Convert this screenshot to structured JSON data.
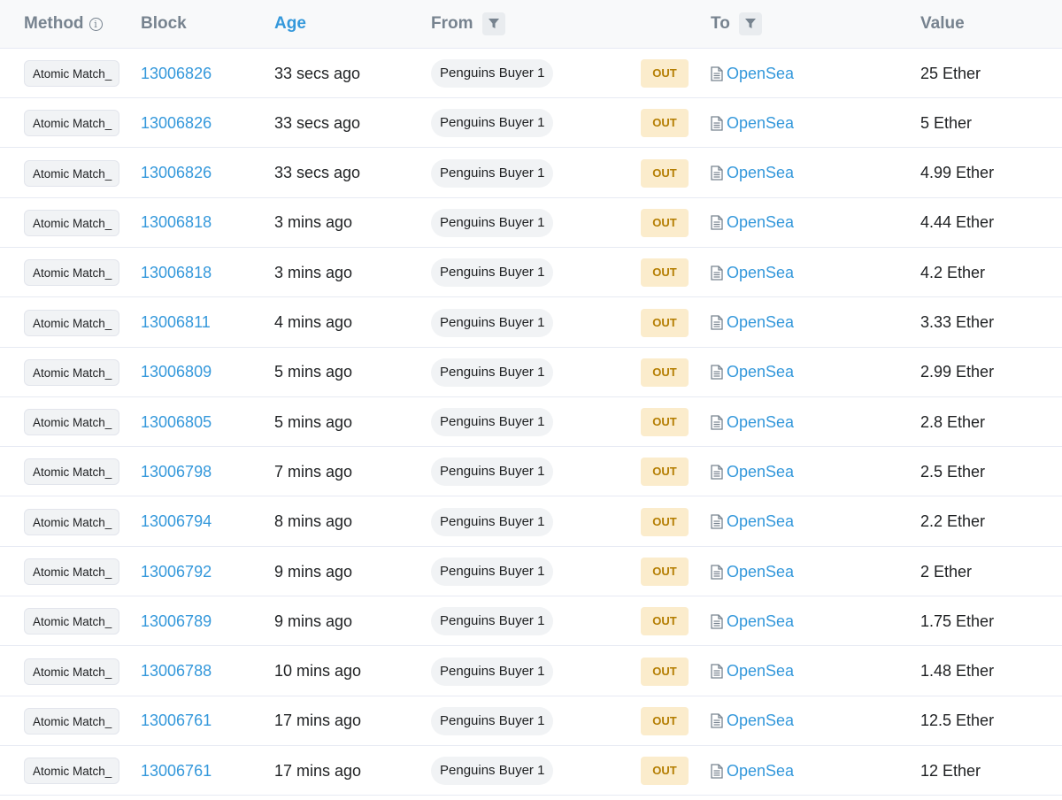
{
  "header": {
    "method": "Method",
    "block": "Block",
    "age": "Age",
    "from": "From",
    "to": "To",
    "value": "Value"
  },
  "rows": [
    {
      "method": "Atomic Match_",
      "block": "13006826",
      "age": "33 secs ago",
      "from": "Penguins Buyer 1",
      "direction": "OUT",
      "to": "OpenSea",
      "value": "25 Ether"
    },
    {
      "method": "Atomic Match_",
      "block": "13006826",
      "age": "33 secs ago",
      "from": "Penguins Buyer 1",
      "direction": "OUT",
      "to": "OpenSea",
      "value": "5 Ether"
    },
    {
      "method": "Atomic Match_",
      "block": "13006826",
      "age": "33 secs ago",
      "from": "Penguins Buyer 1",
      "direction": "OUT",
      "to": "OpenSea",
      "value": "4.99 Ether"
    },
    {
      "method": "Atomic Match_",
      "block": "13006818",
      "age": "3 mins ago",
      "from": "Penguins Buyer 1",
      "direction": "OUT",
      "to": "OpenSea",
      "value": "4.44 Ether"
    },
    {
      "method": "Atomic Match_",
      "block": "13006818",
      "age": "3 mins ago",
      "from": "Penguins Buyer 1",
      "direction": "OUT",
      "to": "OpenSea",
      "value": "4.2 Ether"
    },
    {
      "method": "Atomic Match_",
      "block": "13006811",
      "age": "4 mins ago",
      "from": "Penguins Buyer 1",
      "direction": "OUT",
      "to": "OpenSea",
      "value": "3.33 Ether"
    },
    {
      "method": "Atomic Match_",
      "block": "13006809",
      "age": "5 mins ago",
      "from": "Penguins Buyer 1",
      "direction": "OUT",
      "to": "OpenSea",
      "value": "2.99 Ether"
    },
    {
      "method": "Atomic Match_",
      "block": "13006805",
      "age": "5 mins ago",
      "from": "Penguins Buyer 1",
      "direction": "OUT",
      "to": "OpenSea",
      "value": "2.8 Ether"
    },
    {
      "method": "Atomic Match_",
      "block": "13006798",
      "age": "7 mins ago",
      "from": "Penguins Buyer 1",
      "direction": "OUT",
      "to": "OpenSea",
      "value": "2.5 Ether"
    },
    {
      "method": "Atomic Match_",
      "block": "13006794",
      "age": "8 mins ago",
      "from": "Penguins Buyer 1",
      "direction": "OUT",
      "to": "OpenSea",
      "value": "2.2 Ether"
    },
    {
      "method": "Atomic Match_",
      "block": "13006792",
      "age": "9 mins ago",
      "from": "Penguins Buyer 1",
      "direction": "OUT",
      "to": "OpenSea",
      "value": "2 Ether"
    },
    {
      "method": "Atomic Match_",
      "block": "13006789",
      "age": "9 mins ago",
      "from": "Penguins Buyer 1",
      "direction": "OUT",
      "to": "OpenSea",
      "value": "1.75 Ether"
    },
    {
      "method": "Atomic Match_",
      "block": "13006788",
      "age": "10 mins ago",
      "from": "Penguins Buyer 1",
      "direction": "OUT",
      "to": "OpenSea",
      "value": "1.48 Ether"
    },
    {
      "method": "Atomic Match_",
      "block": "13006761",
      "age": "17 mins ago",
      "from": "Penguins Buyer 1",
      "direction": "OUT",
      "to": "OpenSea",
      "value": "12.5 Ether"
    },
    {
      "method": "Atomic Match_",
      "block": "13006761",
      "age": "17 mins ago",
      "from": "Penguins Buyer 1",
      "direction": "OUT",
      "to": "OpenSea",
      "value": "12 Ether"
    }
  ]
}
